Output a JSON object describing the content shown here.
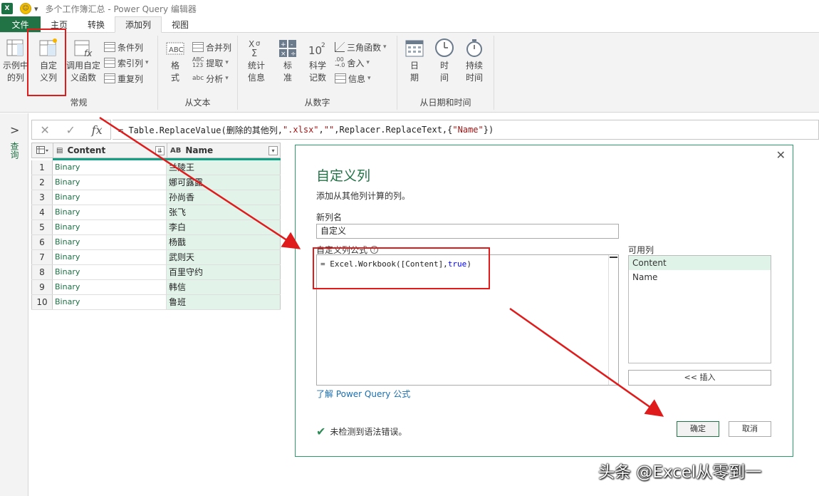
{
  "window": {
    "title": "多个工作簿汇总 - Power Query 编辑器"
  },
  "tabs": [
    {
      "label": "文件"
    },
    {
      "label": "主页"
    },
    {
      "label": "转换"
    },
    {
      "label": "添加列"
    },
    {
      "label": "视图"
    }
  ],
  "ribbon": {
    "general": {
      "group_label": "常规",
      "example_col": [
        "示例中",
        "的列"
      ],
      "custom_col": [
        "自定",
        "义列"
      ],
      "invoke_func": [
        "调用自定",
        "义函数"
      ],
      "conditional": "条件列",
      "index": "索引列",
      "duplicate": "重复列"
    },
    "text": {
      "group_label": "从文本",
      "format": [
        "格",
        "式"
      ],
      "merge": "合并列",
      "extract": "提取",
      "parse": "分析"
    },
    "number": {
      "group_label": "从数字",
      "stats": [
        "统计",
        "信息"
      ],
      "standard": [
        "标",
        "准"
      ],
      "scientific": [
        "科学",
        "记数"
      ],
      "trig": "三角函数",
      "round": "舍入",
      "info": "信息"
    },
    "datetime": {
      "group_label": "从日期和时间",
      "date": [
        "日",
        "期"
      ],
      "time": [
        "时",
        "间"
      ],
      "duration": [
        "持续",
        "时间"
      ]
    }
  },
  "nav": {
    "queries_label": "查询"
  },
  "formula_bar": {
    "fx": "fx",
    "prefix": "= Table.ReplaceValue(删除的其他列,",
    "str1": "\".xlsx\"",
    "comma1": ",",
    "str2": "\"\"",
    "mid": ",Replacer.ReplaceText,{",
    "str3": "\"Name\"",
    "suffix": "})"
  },
  "grid": {
    "columns": [
      {
        "type": "▤",
        "name": "Content"
      },
      {
        "type": "AB",
        "name": "Name"
      }
    ],
    "rows": [
      {
        "n": "1",
        "content": "Binary",
        "name": "兰陵王"
      },
      {
        "n": "2",
        "content": "Binary",
        "name": "娜可露露"
      },
      {
        "n": "3",
        "content": "Binary",
        "name": "孙尚香"
      },
      {
        "n": "4",
        "content": "Binary",
        "name": "张飞"
      },
      {
        "n": "5",
        "content": "Binary",
        "name": "李白"
      },
      {
        "n": "6",
        "content": "Binary",
        "name": "杨戬"
      },
      {
        "n": "7",
        "content": "Binary",
        "name": "武则天"
      },
      {
        "n": "8",
        "content": "Binary",
        "name": "百里守约"
      },
      {
        "n": "9",
        "content": "Binary",
        "name": "韩信"
      },
      {
        "n": "10",
        "content": "Binary",
        "name": "鲁班"
      }
    ]
  },
  "dialog": {
    "title": "自定义列",
    "subtitle": "添加从其他列计算的列。",
    "new_col_label": "新列名",
    "new_col_value": "自定义",
    "formula_label": "自定义列公式",
    "formula_prefix": "= Excel.Workbook([Content],",
    "formula_kw": "true",
    "formula_suffix": ")",
    "available_label": "可用列",
    "available": [
      "Content",
      "Name"
    ],
    "insert": "<< 插入",
    "learn": "了解 Power Query 公式",
    "status": "未检测到语法错误。",
    "ok": "确定",
    "cancel": "取消"
  },
  "watermark": "头条 @Excel从零到一"
}
